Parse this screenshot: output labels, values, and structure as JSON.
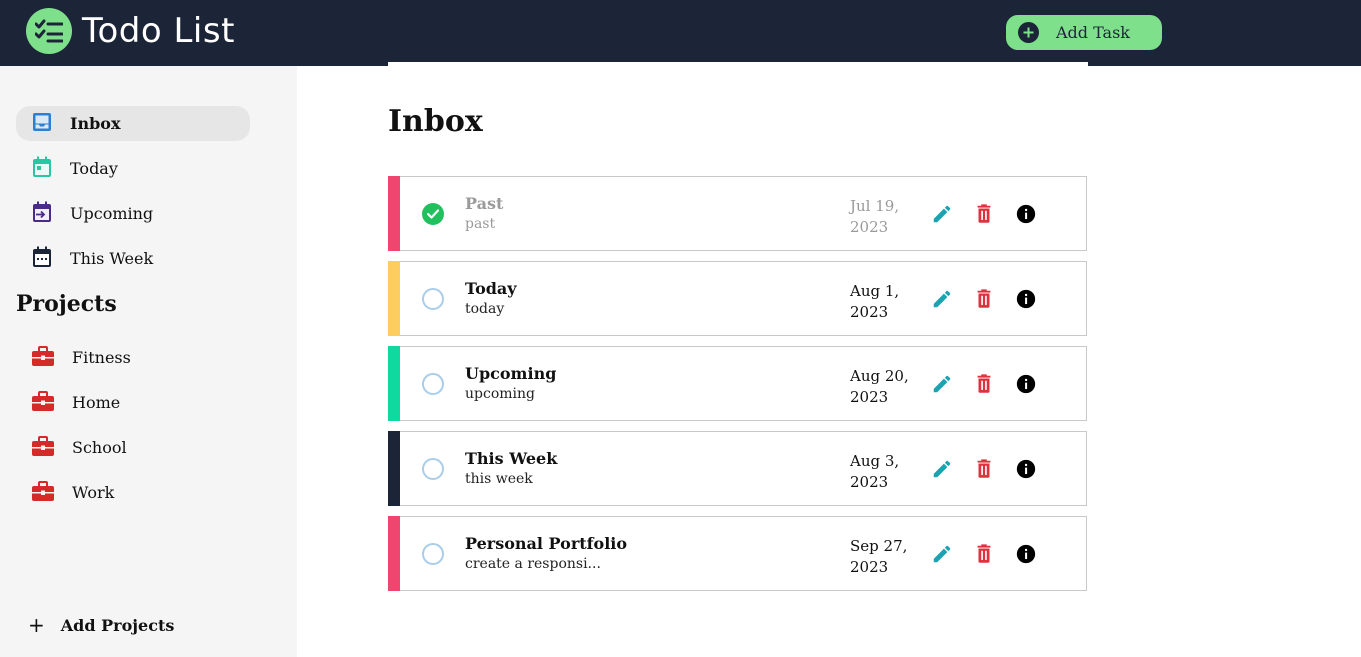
{
  "app": {
    "title": "Todo List"
  },
  "header": {
    "add_task_label": "Add Task"
  },
  "colors": {
    "header_bg": "#1c2438",
    "accent_green": "#7fe08c",
    "priority_high": "#ef4670",
    "priority_medium": "#fdce5f",
    "priority_low": "#10d9a0",
    "priority_none": "#1c2438",
    "done_green": "#21c05f",
    "edit_teal": "#1aa3b0",
    "delete_red": "#e0313e",
    "project_red": "#d42a2a"
  },
  "sidebar": {
    "items": [
      {
        "label": "Inbox",
        "icon": "inbox-icon",
        "active": true
      },
      {
        "label": "Today",
        "icon": "calendar-today-icon",
        "active": false
      },
      {
        "label": "Upcoming",
        "icon": "calendar-upcoming-icon",
        "active": false
      },
      {
        "label": "This Week",
        "icon": "calendar-week-icon",
        "active": false
      }
    ],
    "projects_title": "Projects",
    "projects": [
      {
        "label": "Fitness",
        "icon": "briefcase-icon"
      },
      {
        "label": "Home",
        "icon": "briefcase-icon"
      },
      {
        "label": "School",
        "icon": "briefcase-icon"
      },
      {
        "label": "Work",
        "icon": "briefcase-icon"
      }
    ],
    "add_projects_label": "Add Projects"
  },
  "main": {
    "title": "Inbox",
    "tasks": [
      {
        "title": "Past",
        "description": "past",
        "date": "Jul 19, 2023",
        "priority": "high",
        "completed": true
      },
      {
        "title": "Today",
        "description": "today",
        "date": "Aug 1, 2023",
        "priority": "medium",
        "completed": false
      },
      {
        "title": "Upcoming",
        "description": "upcoming",
        "date": "Aug 20, 2023",
        "priority": "low",
        "completed": false
      },
      {
        "title": "This Week",
        "description": "this week",
        "date": "Aug 3, 2023",
        "priority": "none",
        "completed": false
      },
      {
        "title": "Personal Portfolio",
        "description": "create a responsi...",
        "date": "Sep 27, 2023",
        "priority": "high",
        "completed": false
      }
    ]
  }
}
